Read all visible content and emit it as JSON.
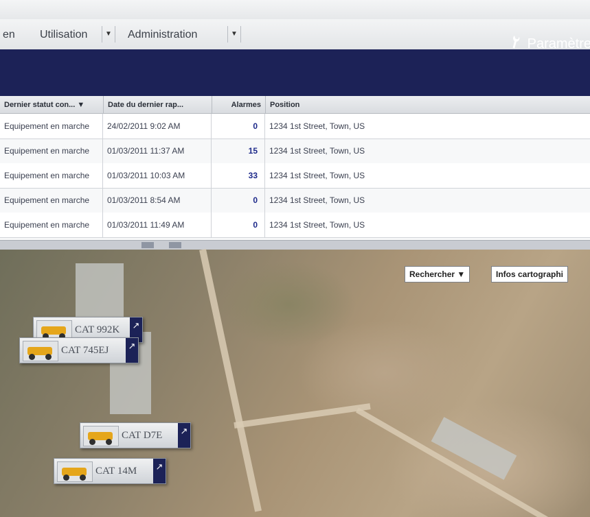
{
  "menu": {
    "items": [
      {
        "label": "en"
      },
      {
        "label": "Utilisation"
      },
      {
        "label": "Administration"
      }
    ],
    "dropdown_glyph": "▼",
    "settings_label": "Paramètre",
    "settings_icon": "wrench-icon"
  },
  "table": {
    "headers": {
      "status": "Dernier statut con... ▼",
      "date": "Date du dernier rap...",
      "alarms": "Alarmes",
      "position": "Position"
    },
    "rows": [
      {
        "status": "Equipement en marche",
        "date": "24/02/2011 9:02 AM",
        "alarms": "0",
        "position": "1234 1st Street, Town, US"
      },
      {
        "status": "Equipement en marche",
        "date": "01/03/2011 11:37 AM",
        "alarms": "15",
        "position": "1234 1st Street, Town, US"
      },
      {
        "status": "Equipement en marche",
        "date": "01/03/2011 10:03 AM",
        "alarms": "33",
        "position": "1234 1st Street, Town, US"
      },
      {
        "status": "Equipement en marche",
        "date": "01/03/2011 8:54 AM",
        "alarms": "0",
        "position": "1234 1st Street, Town, US"
      },
      {
        "status": "Equipement en marche",
        "date": "01/03/2011 11:49 AM",
        "alarms": "0",
        "position": "1234 1st Street, Town, US"
      }
    ]
  },
  "map": {
    "search_label": "Rechercher ▼",
    "map_info_label": "Infos cartographi",
    "markers": [
      {
        "label": "CAT 992K"
      },
      {
        "label": "CAT 745EJ"
      },
      {
        "label": "CAT D7E"
      },
      {
        "label": "CAT 14M"
      }
    ],
    "marker_go_glyph": "↗"
  },
  "colors": {
    "nav_band": "#1c2257",
    "alarm_text": "#1e2a8a",
    "equipment_yellow": "#e5a61b"
  }
}
